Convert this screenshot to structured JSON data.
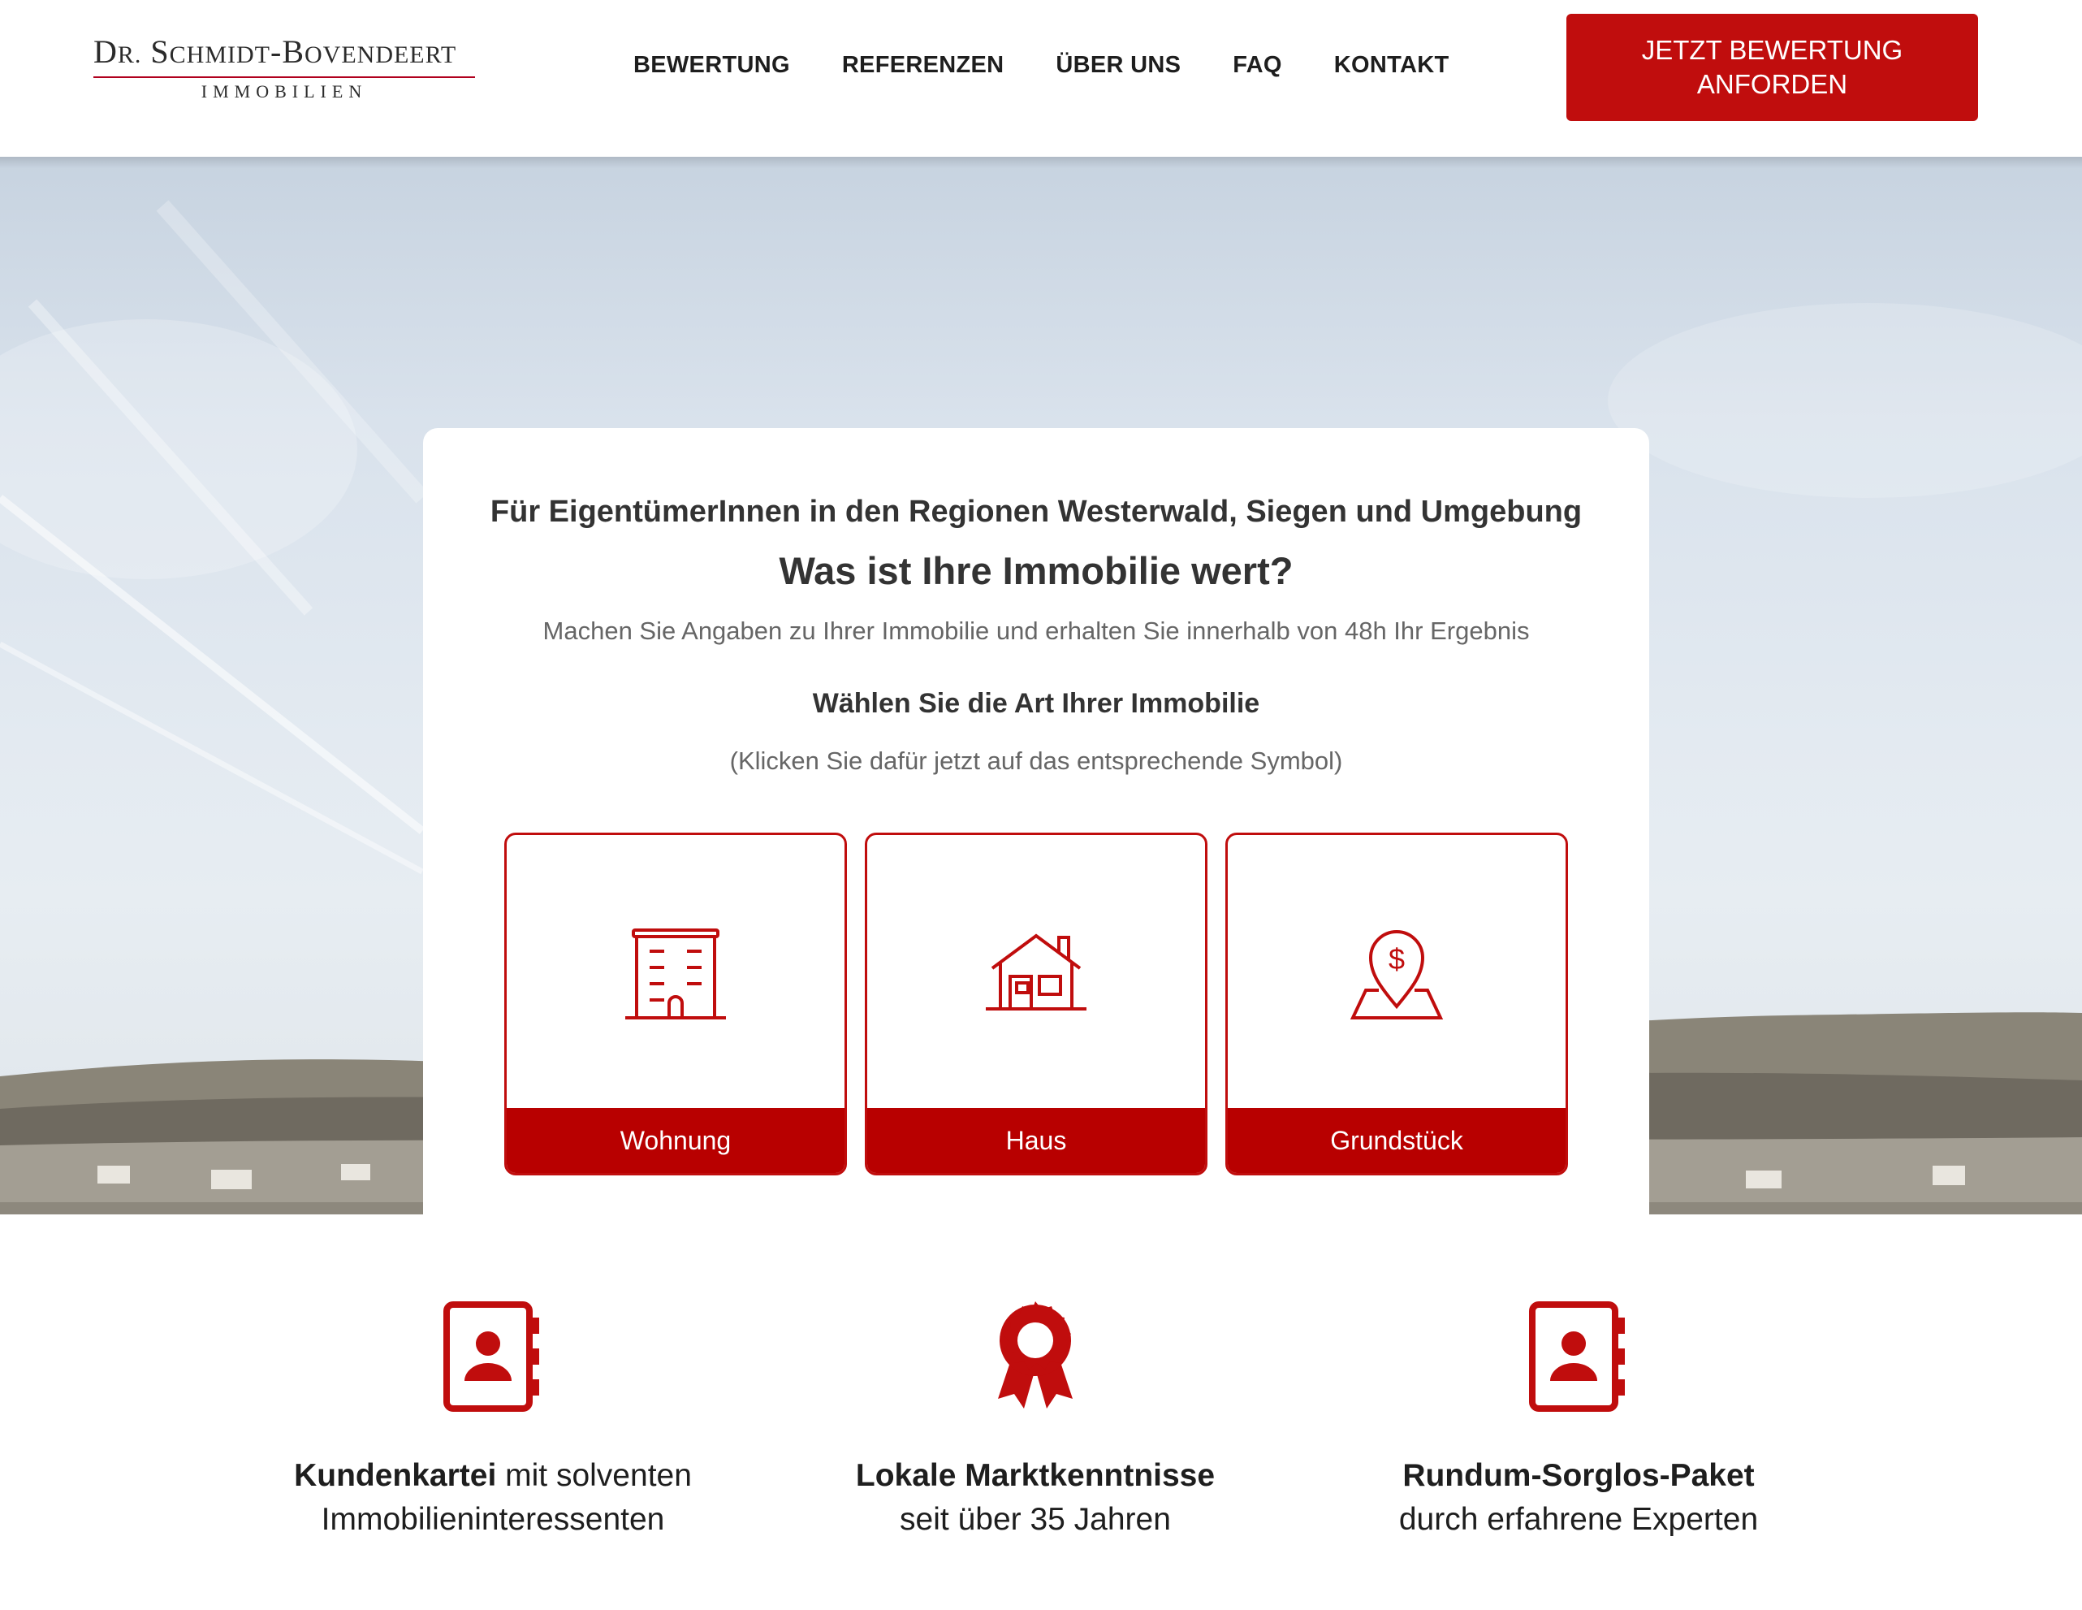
{
  "header": {
    "logo": {
      "line1_initial_dr": "D",
      "line1_rest_dr": "R.",
      "line1_s": "S",
      "line1_chmidt": "CHMIDT",
      "line1_dash_b": "-B",
      "line1_ovendeert": "OVENDEERT",
      "line2": "IMMOBILIEN"
    },
    "nav": [
      "BEWERTUNG",
      "REFERENZEN",
      "ÜBER UNS",
      "FAQ",
      "KONTAKT"
    ],
    "cta": {
      "line1": "JETZT BEWERTUNG",
      "line2": "ANFORDEN"
    }
  },
  "hero": {
    "eyebrow": "Für EigentümerInnen in den Regionen Westerwald, Siegen und Umgebung",
    "title": "Was ist Ihre Immobilie wert?",
    "subtitle": "Machen Sie Angaben zu Ihrer Immobilie und erhalten Sie innerhalb von 48h Ihr Ergebnis",
    "choose": "Wählen Sie die Art Ihrer Immobilie",
    "hint": "(Klicken Sie dafür jetzt auf das entsprechende Symbol)",
    "tiles": [
      {
        "label": "Wohnung",
        "icon": "apartment-building-icon"
      },
      {
        "label": "Haus",
        "icon": "house-icon"
      },
      {
        "label": "Grundstück",
        "icon": "land-plot-dollar-pin-icon"
      }
    ]
  },
  "features": [
    {
      "bold": "Kundenkartei",
      "rest": " mit solventen",
      "line2": "Immobilieninteressenten",
      "icon": "contact-book-icon"
    },
    {
      "bold": "Lokale Marktkenntnisse",
      "rest": "",
      "line2": "seit über 35 Jahren",
      "icon": "award-ribbon-icon"
    },
    {
      "bold": "Rundum-Sorglos-Paket",
      "rest": "",
      "line2": "durch erfahrene Experten",
      "icon": "contact-book-icon"
    }
  ],
  "colors": {
    "brand_red": "#c00d0d",
    "tile_label_red": "#b80000",
    "text_dark": "#333333",
    "text_muted": "#666666"
  }
}
